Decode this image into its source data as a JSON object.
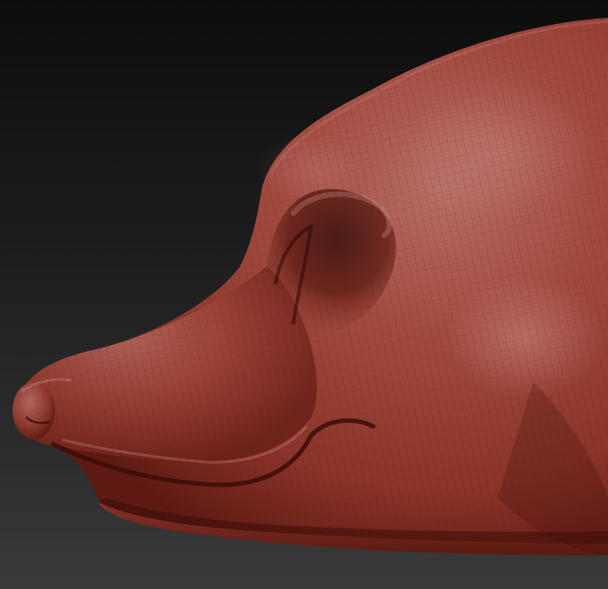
{
  "scene": {
    "subject": "dog-head-sculpt",
    "view": "side-profile",
    "background_top_color": "#0d0d0d",
    "background_bottom_color": "#3a3a3a",
    "clay_base_color": "#8a3328",
    "clay_highlight_color": "#c98a86",
    "clay_shadow_color": "#3a0d08",
    "wireframe_visible": true,
    "wireframe_color": "#5a1c16"
  }
}
